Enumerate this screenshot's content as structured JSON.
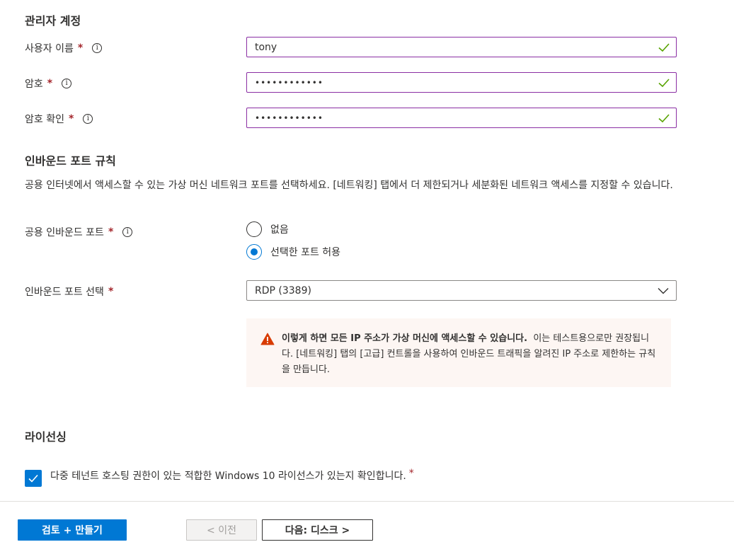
{
  "admin_section": {
    "title": "관리자 계정",
    "username": {
      "label": "사용자 이름",
      "required": "*",
      "value": "tony"
    },
    "password": {
      "label": "암호",
      "required": "*",
      "value": "••••••••••••"
    },
    "confirm_password": {
      "label": "암호 확인",
      "required": "*",
      "value": "••••••••••••"
    }
  },
  "inbound_section": {
    "title": "인바운드 포트 규칙",
    "description": "공용 인터넷에서 액세스할 수 있는 가상 머신 네트워크 포트를 선택하세요. [네트워킹] 탭에서 더 제한되거나 세분화된 네트워크 액세스를 지정할 수 있습니다.",
    "public_ports": {
      "label": "공용 인바운드 포트",
      "required": "*",
      "options": [
        "없음",
        "선택한 포트 허용"
      ],
      "selected": "선택한 포트 허용"
    },
    "select_ports": {
      "label": "인바운드 포트 선택",
      "required": "*",
      "value": "RDP (3389)"
    },
    "warning": {
      "bold": "이렇게 하면 모든 IP 주소가 가상 머신에 액세스할 수 있습니다.",
      "text": "이는 테스트용으로만 권장됩니다.  [네트워킹] 탭의 [고급] 컨트롤을 사용하여 인바운드 트래픽을 알려진 IP 주소로 제한하는 규칙을 만듭니다."
    }
  },
  "licensing_section": {
    "title": "라이선싱",
    "checkbox_label": "다중 테넌트 호스팅 권한이 있는 적합한 Windows 10 라이선스가 있는지 확인합니다.",
    "required": "*",
    "checked": true
  },
  "footer": {
    "review_create": "검토 + 만들기",
    "previous": "< 이전",
    "next": "다음: 디스크 >"
  },
  "colors": {
    "accent": "#0078d4",
    "focus_border": "#8a2ea3",
    "valid_check": "#57a300",
    "required": "#a4262c",
    "warning_icon": "#d83b01"
  }
}
